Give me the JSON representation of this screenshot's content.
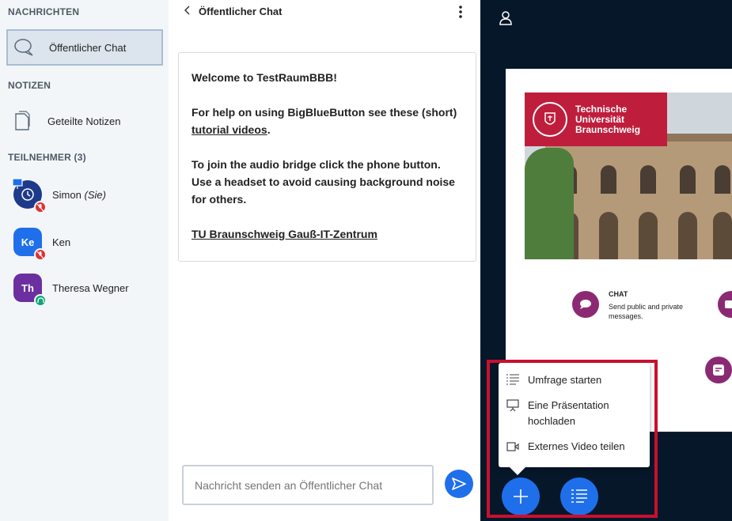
{
  "sidebar": {
    "messages_title": "NACHRICHTEN",
    "public_chat_label": "Öffentlicher Chat",
    "notes_title": "NOTIZEN",
    "shared_notes_label": "Geteilte Notizen",
    "participants_title": "TEILNEHMER (3)",
    "users": [
      {
        "initials": "",
        "name": "Simon",
        "suffix": "(Sie)",
        "color": "#1e3a8a",
        "status": "muted"
      },
      {
        "initials": "Ke",
        "name": "Ken",
        "suffix": "",
        "color": "#1f6feb",
        "status": "muted"
      },
      {
        "initials": "Th",
        "name": "Theresa Wegner",
        "suffix": "",
        "color": "#6b2fa0",
        "status": "listening"
      }
    ]
  },
  "chat": {
    "header_title": "Öffentlicher Chat",
    "welcome_prefix": "Welcome to ",
    "room_name": "TestRaumBBB",
    "welcome_suffix": "!",
    "help_text": "For help on using BigBlueButton see these (short) ",
    "tutorial_link": "tutorial videos",
    "help_end": ".",
    "audio_text": "To join the audio bridge click the phone button. Use a headset to avoid causing background noise for others.",
    "footer_link": "TU Braunschweig Gauß-IT-Zentrum",
    "input_placeholder": "Nachricht senden an Öffentlicher Chat"
  },
  "presentation": {
    "logo_line1": "Technische",
    "logo_line2": "Universität",
    "logo_line3": "Braunschweig",
    "feature_chat_title": "CHAT",
    "feature_chat_desc": "Send public and private messages."
  },
  "actions_menu": {
    "start_poll": "Umfrage starten",
    "upload_presentation": "Eine Präsentation hochladen",
    "share_video": "Externes Video teilen"
  },
  "colors": {
    "accent": "#1f6feb",
    "highlight": "#c8102e",
    "muted_badge": "#e03131",
    "listen_badge": "#0ca678"
  }
}
